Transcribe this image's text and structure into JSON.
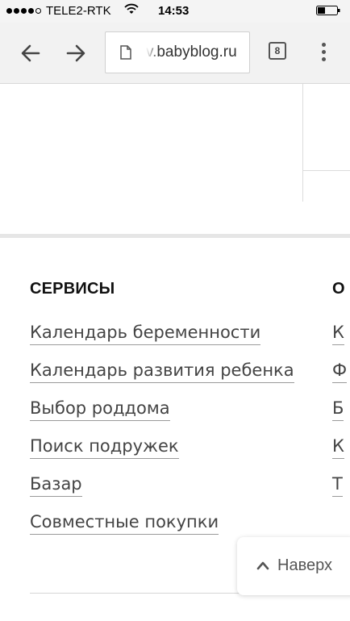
{
  "status_bar": {
    "carrier": "TELE2-RTK",
    "time": "14:53"
  },
  "browser": {
    "url": "v.babyblog.ru",
    "tab_count": "8"
  },
  "footer": {
    "col1": {
      "title": "СЕРВИСЫ",
      "links": [
        "Календарь беременности",
        "Календарь развития ребенка",
        "Выбор роддома",
        "Поиск подружек",
        "Базар",
        "Совместные покупки"
      ]
    },
    "col2": {
      "title": "О",
      "links": [
        "К",
        "Ф",
        "Б",
        "К",
        "Т"
      ]
    }
  },
  "back_to_top": {
    "label": "Наверх"
  }
}
